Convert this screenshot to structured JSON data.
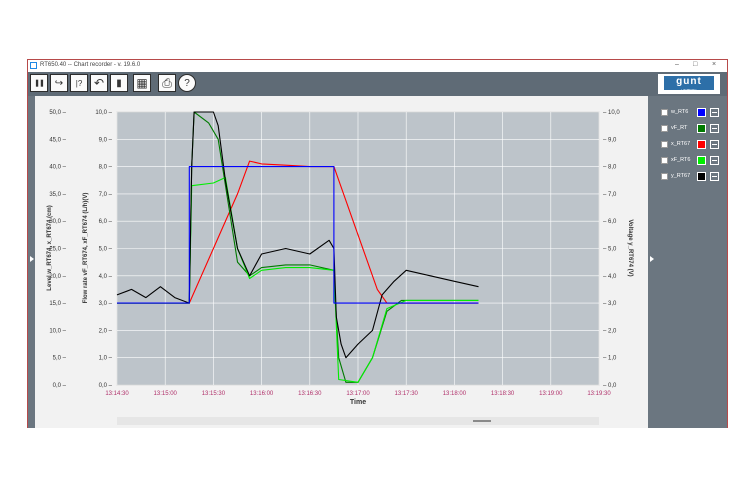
{
  "window": {
    "title": "RT650.40  --  Chart recorder - v. 19.6.0",
    "controls": {
      "minimize": "–",
      "restore": "□",
      "close": "×"
    }
  },
  "toolbar": {
    "buttons": [
      {
        "name": "pause-button",
        "icon": "pause-icon",
        "glyph": "❚❚"
      },
      {
        "name": "export-button",
        "icon": "export-icon",
        "glyph": "↪"
      },
      {
        "name": "help-context-button",
        "icon": "question-pointer-icon",
        "glyph": "|?"
      },
      {
        "name": "undo-button",
        "icon": "undo-icon",
        "glyph": "↶"
      },
      {
        "name": "delete-button",
        "icon": "trash-icon",
        "glyph": "▮"
      },
      {
        "name": "grid-button",
        "icon": "grid-icon",
        "glyph": "▦"
      },
      {
        "name": "print-button",
        "icon": "printer-icon",
        "glyph": "⎙"
      },
      {
        "name": "help-button",
        "icon": "help-circle-icon",
        "glyph": "?"
      }
    ],
    "logo": {
      "main": "gunt",
      "sub": "HAMBURG"
    }
  },
  "legend": [
    {
      "label": "w_RT6",
      "color": "#0000ff"
    },
    {
      "label": "vF_RT",
      "color": "#007a00"
    },
    {
      "label": "x_RT67",
      "color": "#ff0000"
    },
    {
      "label": "xF_RT6",
      "color": "#00ee00"
    },
    {
      "label": "y_RT67",
      "color": "#000000"
    }
  ],
  "chart_data": {
    "type": "line",
    "xlabel": "Time",
    "x_ticks": [
      "13:14:30",
      "13:15:00",
      "13:15:30",
      "13:16:00",
      "13:16:30",
      "13:17:00",
      "13:17:30",
      "13:18:00",
      "13:18:30",
      "13:19:00",
      "13:19:30"
    ],
    "left_axis_1": {
      "label": "Level   w_RT674, x_RT674   (cm)",
      "ticks": [
        "0,0",
        "5,0",
        "10,0",
        "15,0",
        "20,0",
        "25,0",
        "30,0",
        "35,0",
        "40,0",
        "45,0",
        "50,0"
      ],
      "range": [
        0,
        50
      ]
    },
    "left_axis_2": {
      "label": "Flow rate   vF_RT674, xF_RT674   (L/h)(V)",
      "ticks": [
        "0,0",
        "1,0",
        "2,0",
        "3,0",
        "4,0",
        "5,0",
        "6,0",
        "7,0",
        "8,0",
        "9,0",
        "10,0"
      ],
      "range": [
        0,
        10
      ]
    },
    "right_axis": {
      "label": "Voltage   y_RT674   (V)",
      "ticks": [
        "0,0",
        "1,0",
        "2,0",
        "3,0",
        "4,0",
        "5,0",
        "6,0",
        "7,0",
        "8,0",
        "9,0",
        "10,0"
      ],
      "range": [
        0,
        10
      ]
    },
    "grid": true,
    "series": [
      {
        "name": "w_RT6",
        "color": "#0000ff",
        "points": [
          [
            0,
            3.0
          ],
          [
            1.5,
            3.0
          ],
          [
            1.5,
            8.0
          ],
          [
            4.5,
            8.0
          ],
          [
            4.5,
            3.0
          ],
          [
            7.5,
            3.0
          ]
        ]
      },
      {
        "name": "x_RT67",
        "color": "#ff0000",
        "points": [
          [
            0,
            3.0
          ],
          [
            1.5,
            3.0
          ],
          [
            2.0,
            5.0
          ],
          [
            2.5,
            7.0
          ],
          [
            2.75,
            8.2
          ],
          [
            3.0,
            8.1
          ],
          [
            3.5,
            8.05
          ],
          [
            4.0,
            8.0
          ],
          [
            4.5,
            8.0
          ],
          [
            5.0,
            5.5
          ],
          [
            5.4,
            3.5
          ],
          [
            5.6,
            3.0
          ],
          [
            6.0,
            3.0
          ],
          [
            7.5,
            3.0
          ]
        ]
      },
      {
        "name": "vF_RT",
        "color": "#007a00",
        "points": [
          [
            0,
            3.0
          ],
          [
            1.5,
            3.0
          ],
          [
            1.55,
            8.0
          ],
          [
            1.6,
            10.0
          ],
          [
            1.9,
            9.6
          ],
          [
            2.1,
            9.0
          ],
          [
            2.5,
            4.5
          ],
          [
            2.75,
            4.0
          ],
          [
            3.0,
            4.3
          ],
          [
            3.5,
            4.4
          ],
          [
            4.0,
            4.4
          ],
          [
            4.5,
            4.2
          ],
          [
            4.55,
            2.5
          ],
          [
            4.6,
            1.0
          ],
          [
            4.75,
            0.1
          ],
          [
            5.0,
            0.1
          ],
          [
            5.3,
            1.0
          ],
          [
            5.6,
            2.7
          ],
          [
            5.9,
            3.1
          ],
          [
            6.5,
            3.1
          ],
          [
            7.5,
            3.1
          ]
        ]
      },
      {
        "name": "xF_RT6",
        "color": "#00ee00",
        "points": [
          [
            0,
            3.0
          ],
          [
            1.5,
            3.0
          ],
          [
            1.55,
            7.3
          ],
          [
            2.0,
            7.4
          ],
          [
            2.25,
            7.6
          ],
          [
            2.5,
            5.0
          ],
          [
            2.75,
            3.9
          ],
          [
            3.0,
            4.2
          ],
          [
            3.5,
            4.3
          ],
          [
            4.0,
            4.3
          ],
          [
            4.5,
            4.2
          ],
          [
            4.6,
            0.2
          ],
          [
            5.0,
            0.1
          ],
          [
            5.3,
            1.0
          ],
          [
            5.6,
            2.8
          ],
          [
            6.0,
            3.1
          ],
          [
            7.5,
            3.1
          ]
        ]
      },
      {
        "name": "y_RT67",
        "color": "#000000",
        "points": [
          [
            0,
            3.3
          ],
          [
            0.3,
            3.5
          ],
          [
            0.6,
            3.2
          ],
          [
            0.9,
            3.6
          ],
          [
            1.2,
            3.2
          ],
          [
            1.5,
            3.0
          ],
          [
            1.55,
            8.0
          ],
          [
            1.6,
            10.0
          ],
          [
            2.0,
            10.0
          ],
          [
            2.1,
            9.5
          ],
          [
            2.25,
            7.5
          ],
          [
            2.5,
            5.0
          ],
          [
            2.75,
            4.0
          ],
          [
            3.0,
            4.8
          ],
          [
            3.5,
            5.0
          ],
          [
            4.0,
            4.8
          ],
          [
            4.4,
            5.3
          ],
          [
            4.5,
            5.0
          ],
          [
            4.55,
            2.5
          ],
          [
            4.65,
            1.5
          ],
          [
            4.75,
            1.0
          ],
          [
            5.0,
            1.5
          ],
          [
            5.3,
            2.0
          ],
          [
            5.5,
            3.3
          ],
          [
            5.75,
            3.8
          ],
          [
            6.0,
            4.2
          ],
          [
            6.5,
            4.0
          ],
          [
            7.0,
            3.8
          ],
          [
            7.5,
            3.6
          ]
        ]
      }
    ]
  }
}
